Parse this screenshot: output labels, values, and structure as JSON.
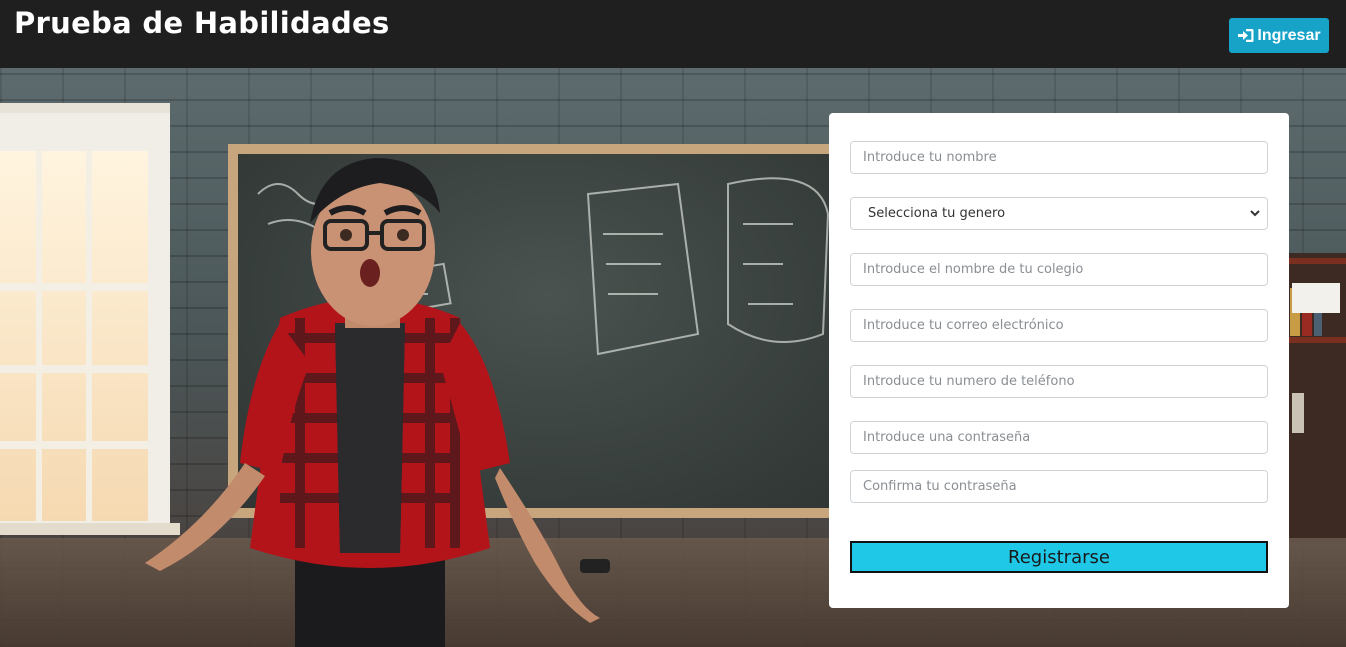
{
  "header": {
    "title": "Prueba de Habilidades",
    "login_label": "Ingresar",
    "login_icon": "sign-in-icon"
  },
  "form": {
    "name_placeholder": "Introduce tu nombre",
    "gender_selected": "Selecciona tu genero",
    "school_placeholder": "Introduce el nombre de tu colegio",
    "email_placeholder": "Introduce tu correo electrónico",
    "phone_placeholder": "Introduce tu numero de teléfono",
    "password_placeholder": "Introduce una contraseña",
    "confirm_placeholder": "Confirma tu contraseña",
    "submit_label": "Registrarse"
  },
  "colors": {
    "topbar": "#1f1f1f",
    "accent_button": "#17a2c8",
    "submit_button": "#1ec8e6"
  }
}
